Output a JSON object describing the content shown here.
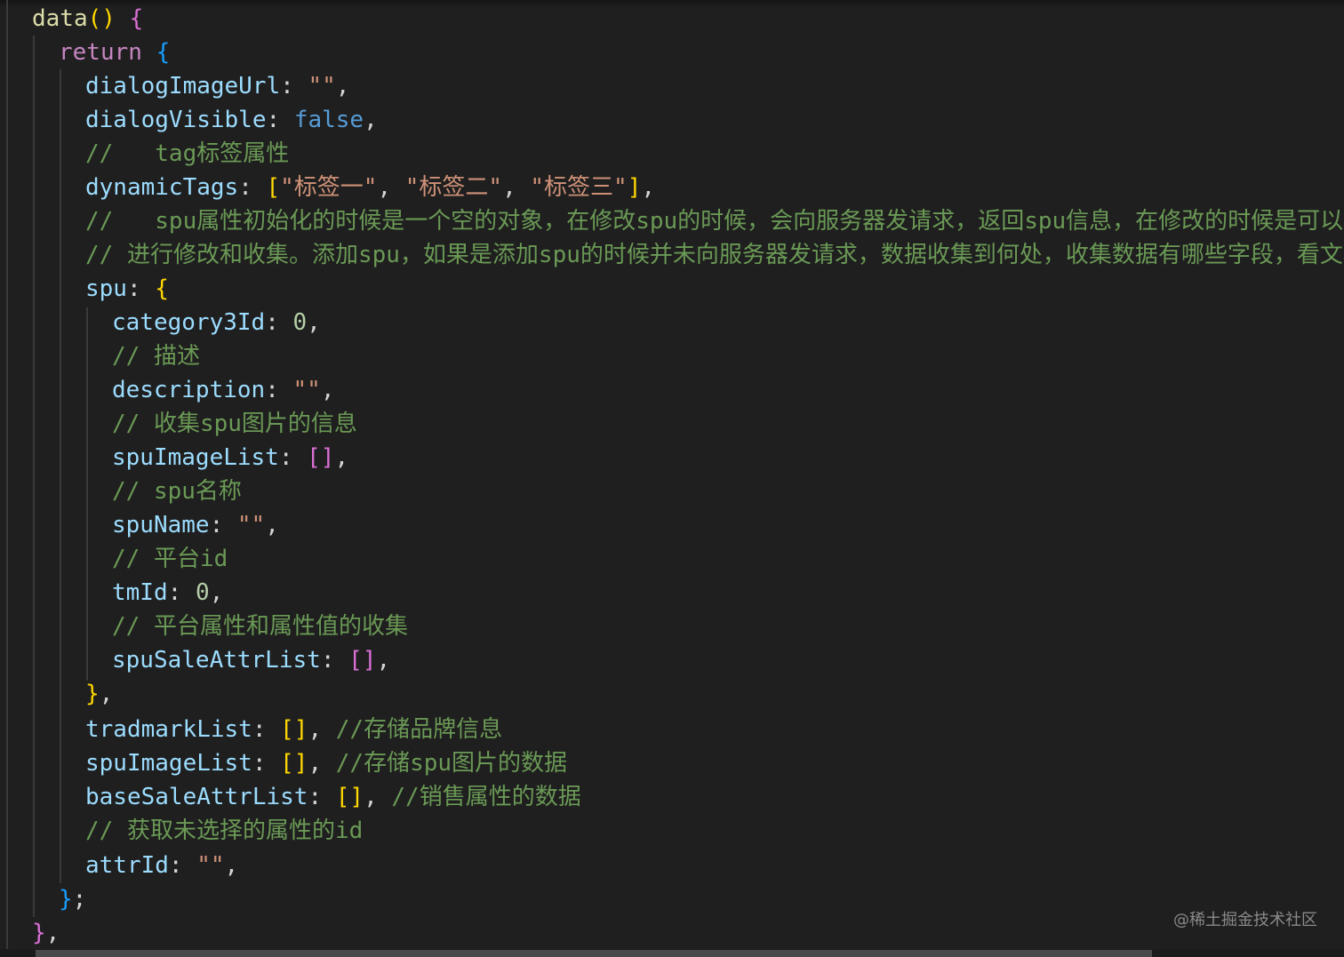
{
  "code": {
    "l01": {
      "fn": "data",
      "paren": "()",
      "brace": "{"
    },
    "l02": {
      "kw": "return",
      "brace": "{"
    },
    "l03": {
      "prop": "dialogImageUrl",
      "colon": ":",
      "str": "\"\"",
      "comma": ","
    },
    "l04": {
      "prop": "dialogVisible",
      "colon": ":",
      "val": "false",
      "comma": ","
    },
    "l05": {
      "comment": "//   tag标签属性"
    },
    "l06": {
      "prop": "dynamicTags",
      "colon": ":",
      "open": "[",
      "s1": "\"标签一\"",
      "sep1": ", ",
      "s2": "\"标签二\"",
      "sep2": ", ",
      "s3": "\"标签三\"",
      "close": "]",
      "comma": ","
    },
    "l07": {
      "comment": "//   spu属性初始化的时候是一个空的对象，在修改spu的时候，会向服务器发请求，返回spu信息，在修改的时候是可以利用"
    },
    "l08": {
      "comment": "// 进行修改和收集。添加spu，如果是添加spu的时候并未向服务器发请求，数据收集到何处，收集数据有哪些字段，看文档。"
    },
    "l09": {
      "prop": "spu",
      "colon": ":",
      "brace": "{"
    },
    "l10": {
      "prop": "category3Id",
      "colon": ":",
      "num": "0",
      "comma": ","
    },
    "l11": {
      "comment": "// 描述"
    },
    "l12": {
      "prop": "description",
      "colon": ":",
      "str": "\"\"",
      "comma": ","
    },
    "l13": {
      "comment": "// 收集spu图片的信息"
    },
    "l14": {
      "prop": "spuImageList",
      "colon": ":",
      "arr": "[]",
      "comma": ","
    },
    "l15": {
      "comment": "// spu名称"
    },
    "l16": {
      "prop": "spuName",
      "colon": ":",
      "str": "\"\"",
      "comma": ","
    },
    "l17": {
      "comment": "// 平台id"
    },
    "l18": {
      "prop": "tmId",
      "colon": ":",
      "num": "0",
      "comma": ","
    },
    "l19": {
      "comment": "// 平台属性和属性值的收集"
    },
    "l20": {
      "prop": "spuSaleAttrList",
      "colon": ":",
      "arr": "[]",
      "comma": ","
    },
    "l21": {
      "brace": "}",
      "comma": ","
    },
    "l22": {
      "prop": "tradmarkList",
      "colon": ":",
      "arr": "[]",
      "comma": ",",
      "comment": "//存储品牌信息"
    },
    "l23": {
      "prop": "spuImageList",
      "colon": ":",
      "arr": "[]",
      "comma": ",",
      "comment": "//存储spu图片的数据"
    },
    "l24": {
      "prop": "baseSaleAttrList",
      "colon": ":",
      "arr": "[]",
      "comma": ",",
      "comment": "//销售属性的数据"
    },
    "l25": {
      "comment": "// 获取未选择的属性的id"
    },
    "l26": {
      "prop": "attrId",
      "colon": ":",
      "str": "\"\"",
      "comma": ","
    },
    "l27": {
      "brace": "}",
      "semi": ";"
    },
    "l28": {
      "brace": "}",
      "comma": ","
    }
  },
  "watermark": "@稀土掘金技术社区",
  "colors": {
    "background": "#1f1f1f",
    "function": "#dcdcaa",
    "keyword": "#c586c0",
    "property": "#9cdcfe",
    "string": "#ce9178",
    "number": "#b5cea8",
    "boolean": "#569cd6",
    "comment": "#6a9955",
    "bracket_level1": "#ffd700",
    "bracket_level2": "#da70d6",
    "bracket_level3": "#179fff"
  }
}
